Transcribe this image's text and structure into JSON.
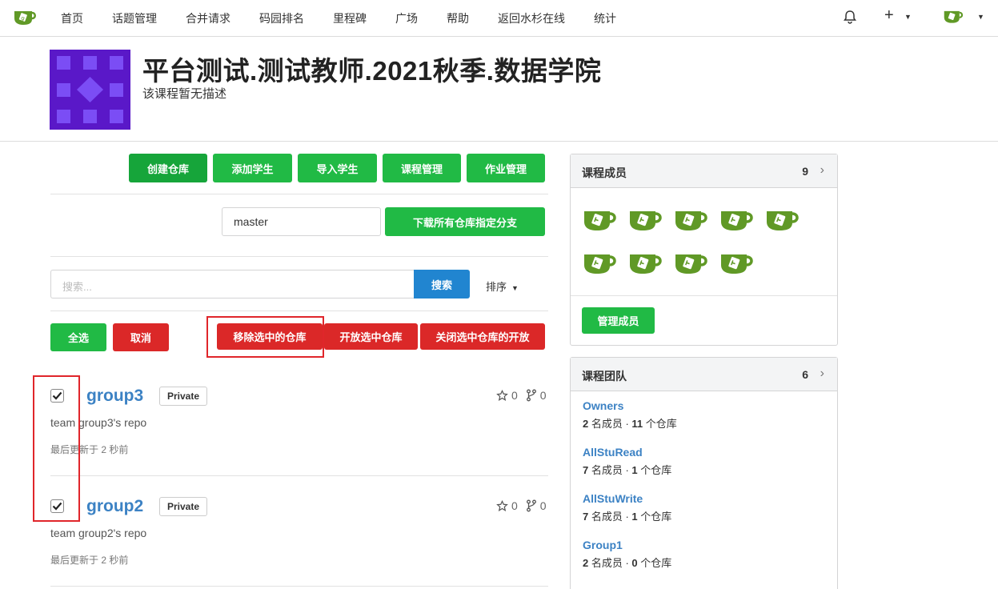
{
  "nav": {
    "items": [
      "首页",
      "话题管理",
      "合并请求",
      "码园排名",
      "里程碑",
      "广场",
      "帮助",
      "返回水杉在线",
      "统计"
    ],
    "plus": "+"
  },
  "course": {
    "title": "平台测试.测试教师.2021秋季.数据学院",
    "description": "该课程暂无描述"
  },
  "actions": {
    "create_repo": "创建仓库",
    "add_student": "添加学生",
    "import_student": "导入学生",
    "course_manage": "课程管理",
    "homework_manage": "作业管理"
  },
  "branch": {
    "value": "master",
    "download_label": "下载所有仓库指定分支"
  },
  "search": {
    "placeholder": "搜索...",
    "button": "搜索",
    "sort_label": "排序"
  },
  "selection": {
    "select_all": "全选",
    "cancel": "取消",
    "remove_selected": "移除选中的仓库",
    "open_selected": "开放选中仓库",
    "close_selected": "关闭选中仓库的开放"
  },
  "repos": [
    {
      "name": "group3",
      "badge": "Private",
      "stars": "0",
      "forks": "0",
      "description": "team group3's repo",
      "updated": "最后更新于 2 秒前",
      "checked": true
    },
    {
      "name": "group2",
      "badge": "Private",
      "stars": "0",
      "forks": "0",
      "description": "team group2's repo",
      "updated": "最后更新于 2 秒前",
      "checked": true
    }
  ],
  "members_card": {
    "title": "课程成员",
    "count": "9",
    "manage_button": "管理成员"
  },
  "teams_card": {
    "title": "课程团队",
    "count": "6",
    "teams": [
      {
        "name": "Owners",
        "members": "2",
        "members_text": " 名成员 · ",
        "repos": "11",
        "repos_text": " 个仓库"
      },
      {
        "name": "AllStuRead",
        "members": "7",
        "members_text": " 名成员 · ",
        "repos": "1",
        "repos_text": " 个仓库"
      },
      {
        "name": "AllStuWrite",
        "members": "7",
        "members_text": " 名成员 · ",
        "repos": "1",
        "repos_text": " 个仓库"
      },
      {
        "name": "Group1",
        "members": "2",
        "members_text": " 名成员 · ",
        "repos": "0",
        "repos_text": " 个仓库"
      }
    ]
  },
  "colors": {
    "green": "#21ba45",
    "red": "#db2828",
    "blue": "#2185d0",
    "link": "#3c82c4",
    "brand": "#609926",
    "course_avatar": "#5a18c8"
  }
}
